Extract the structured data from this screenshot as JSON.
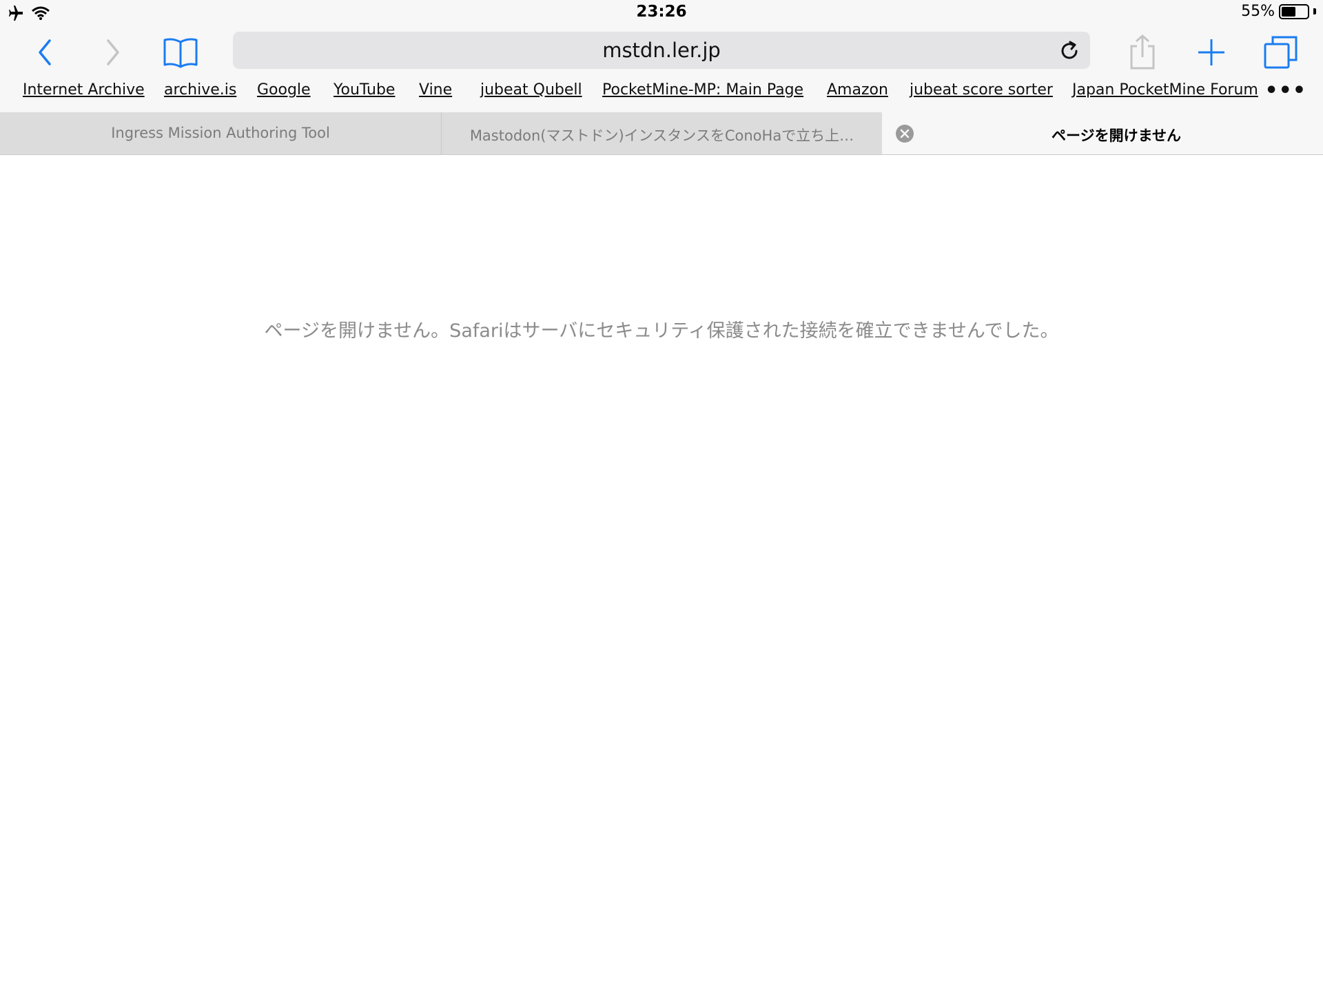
{
  "status_bar": {
    "time": "23:26",
    "battery_percent": "55%",
    "battery_level": 0.55
  },
  "toolbar": {
    "url": "mstdn.ler.jp",
    "icons": {
      "back": "chevron-left-icon",
      "forward": "chevron-right-icon",
      "bookmarks": "book-icon",
      "reload": "reload-icon",
      "share": "share-icon",
      "new_tab": "plus-icon",
      "tabs": "tabs-overview-icon"
    }
  },
  "favorites": {
    "items": [
      {
        "label": "Internet Archive"
      },
      {
        "label": "archive.is"
      },
      {
        "label": "Google"
      },
      {
        "label": "YouTube"
      },
      {
        "label": "Vine"
      },
      {
        "label": "jubeat Qubell"
      },
      {
        "label": "PocketMine-MP: Main Page"
      },
      {
        "label": "Amazon"
      },
      {
        "label": "jubeat score sorter"
      },
      {
        "label": "Japan PocketMine Forum"
      }
    ],
    "more": "•••"
  },
  "tabs": [
    {
      "label": "Ingress Mission Authoring Tool",
      "active": false
    },
    {
      "label": "Mastodon(マストドン)インスタンスをConoHaで立ち上…",
      "active": false
    },
    {
      "label": "ページを開けません",
      "active": true
    }
  ],
  "content": {
    "error_message": "ページを開けません。Safariはサーバにセキュリティ保護された接続を確立できませんでした。"
  },
  "colors": {
    "accent": "#1a7cf0",
    "disabled": "#c4c4c4",
    "chrome_bg": "#f7f7f7",
    "tab_inactive_bg": "#dcdcdc",
    "message_gray": "#8b8b8b"
  }
}
